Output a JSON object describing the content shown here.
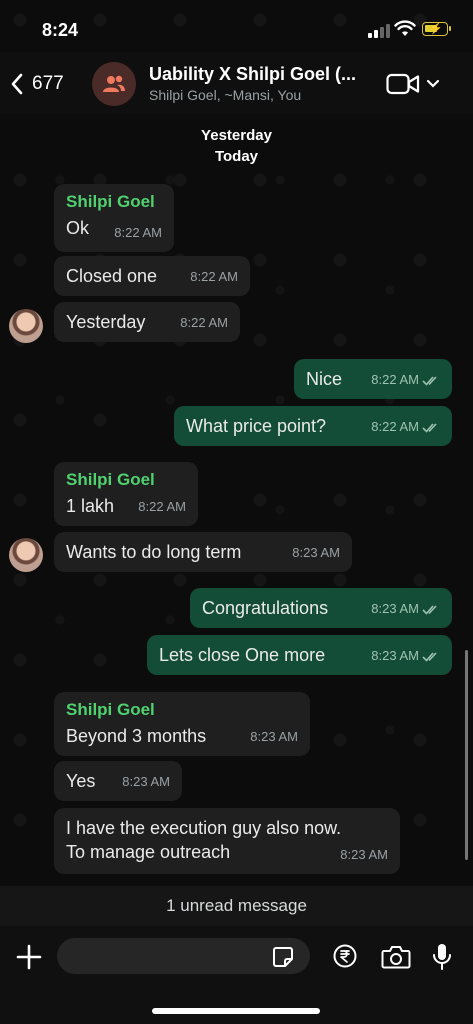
{
  "status": {
    "time": "8:24"
  },
  "header": {
    "back_count": "677",
    "title": "Uability X Shilpi Goel (...",
    "subtitle": "Shilpi Goel, ~Mansi, You"
  },
  "dates": [
    "Yesterday",
    "Today"
  ],
  "messages": [
    {
      "dir": "in",
      "sender": "Shilpi Goel",
      "text": "Ok",
      "time": "8:22 AM"
    },
    {
      "dir": "in",
      "text": "Closed one",
      "time": "8:22 AM"
    },
    {
      "dir": "in",
      "text": "Yesterday",
      "time": "8:22 AM"
    },
    {
      "dir": "out",
      "text": "Nice",
      "time": "8:22 AM"
    },
    {
      "dir": "out",
      "text": "What price point?",
      "time": "8:22 AM"
    },
    {
      "dir": "in",
      "sender": "Shilpi Goel",
      "text": "1 lakh",
      "time": "8:22 AM"
    },
    {
      "dir": "in",
      "text": "Wants to do long term",
      "time": "8:23 AM"
    },
    {
      "dir": "out",
      "text": "Congratulations",
      "time": "8:23 AM"
    },
    {
      "dir": "out",
      "text": "Lets close One more",
      "time": "8:23 AM"
    },
    {
      "dir": "in",
      "sender": "Shilpi Goel",
      "text": "Beyond 3 months",
      "time": "8:23 AM"
    },
    {
      "dir": "in",
      "text": "Yes",
      "time": "8:23 AM"
    },
    {
      "dir": "in",
      "text_line1": "I have the execution guy also now.",
      "text_line2": "To manage outreach",
      "time": "8:23 AM"
    }
  ],
  "unread_banner": "1 unread message",
  "input": {
    "placeholder": "",
    "value": ""
  },
  "colors": {
    "outgoing_bubble": "#134d37",
    "incoming_bubble": "#1f1f1f",
    "sender_name": "#4fd16f"
  },
  "icons": [
    "back-chevron-icon",
    "group-icon",
    "video-call-icon",
    "chevron-down-icon",
    "plus-icon",
    "sticker-icon",
    "rupee-icon",
    "camera-icon",
    "microphone-icon",
    "double-check-icon"
  ]
}
